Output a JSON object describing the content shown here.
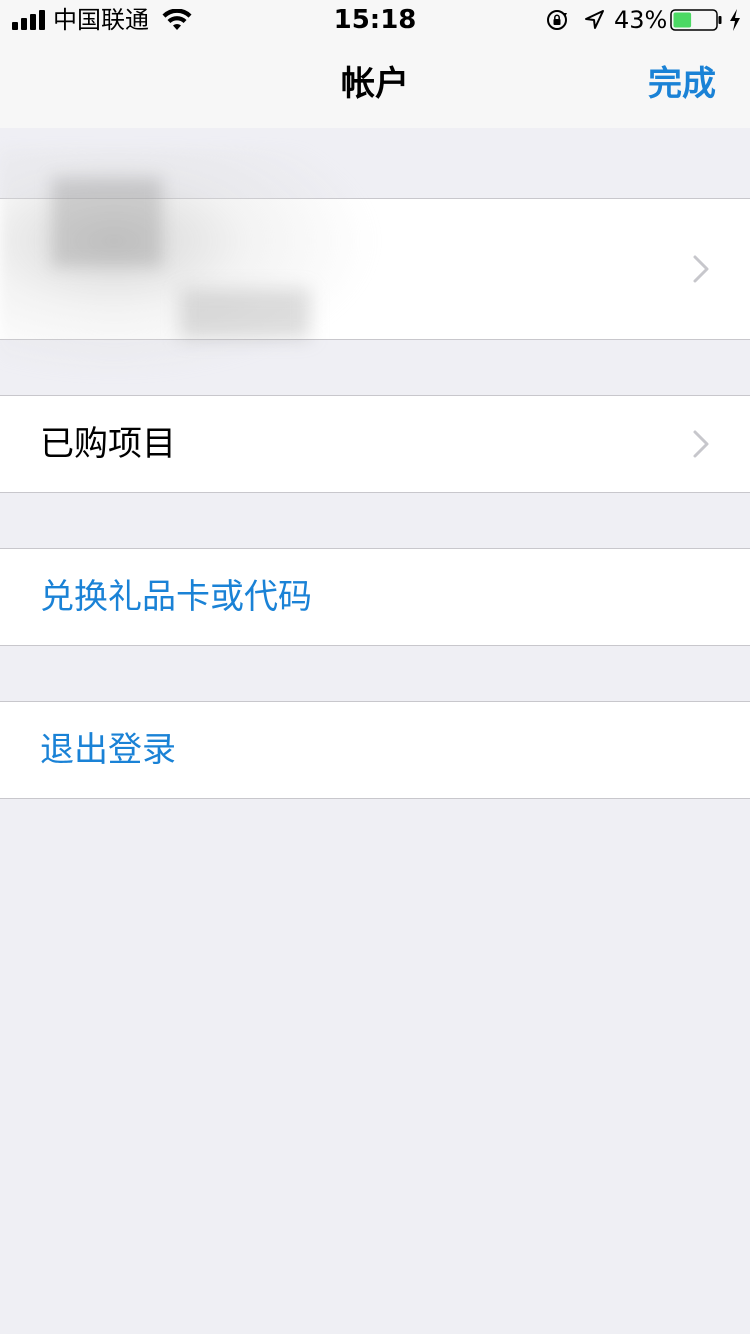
{
  "status_bar": {
    "carrier": "中国联通",
    "time": "15:18",
    "battery_percent": "43%",
    "battery_level": 0.43,
    "battery_color": "#4cd964"
  },
  "nav": {
    "title": "帐户",
    "done_label": "完成"
  },
  "cells": {
    "purchases_label": "已购项目",
    "redeem_label": "兑换礼品卡或代码",
    "signout_label": "退出登录"
  },
  "colors": {
    "accent": "#1a82d6",
    "background": "#efeff4",
    "separator": "#c8c7cc",
    "chevron": "#c7c7cc"
  }
}
